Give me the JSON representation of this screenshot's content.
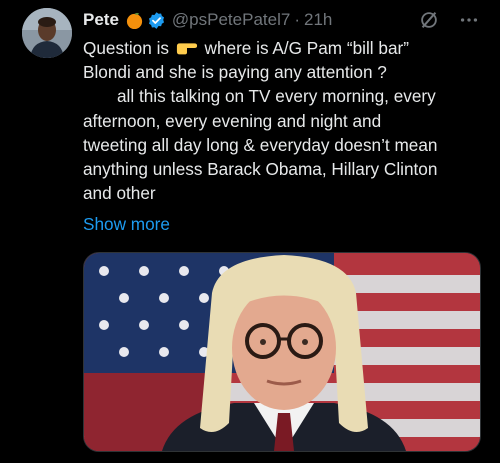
{
  "author": {
    "name": "Pete",
    "handle": "@psPetePatel7",
    "separator": "·",
    "time": "21h"
  },
  "icons": {
    "orange_emoji": "orange-fruit-icon",
    "verified": "verified-badge-icon",
    "grok": "grok-icon",
    "more": "more-icon",
    "pointing": "pointing-right-icon"
  },
  "tweet": {
    "line1_a": "Question is",
    "line1_b": "where is A/G Pam “bill bar”",
    "line2": "Blondi and she is paying any attention ?",
    "line3": "all this talking on TV every morning, every",
    "line4": "afternoon, every evening and night and",
    "line5": "tweeting all day long & everyday doesn’t mean",
    "line6": "anything unless Barack Obama, Hillary Clinton",
    "line7": "and other",
    "show_more": "Show more"
  },
  "colors": {
    "background": "#000000",
    "text": "#e7e9ea",
    "muted": "#71767b",
    "link": "#1d9bf0",
    "verified": "#1d9bf0"
  }
}
